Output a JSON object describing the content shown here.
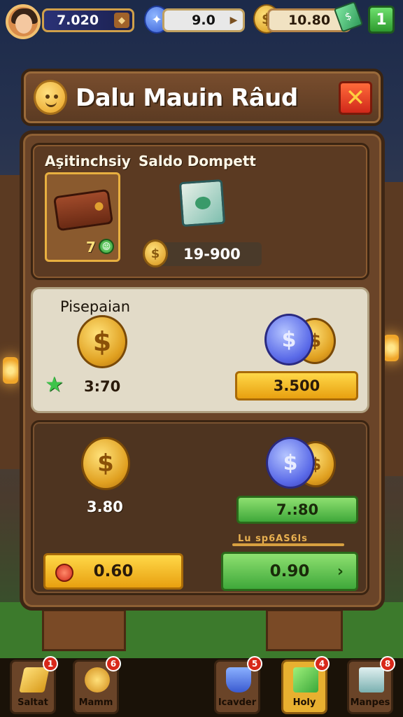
{
  "topbar": {
    "stat_1": "7.020",
    "stat_2": "9.0",
    "stat_3": "10.80",
    "plus_label": "1"
  },
  "dialog": {
    "title": "Dalu Mauin Râud",
    "close_label": "✕"
  },
  "wallet_section": {
    "label_left": "Aşitinchsiy",
    "label_right": "Saldo Dompett",
    "wallet_count": "7",
    "balance": "19-900"
  },
  "exchange_section": {
    "label": "Pisepaian",
    "left_value": "3:70",
    "right_button": "3.500"
  },
  "offer_section": {
    "left_value": "3.80",
    "right_button": "7.:80",
    "scribble": "Lu sp6AS6ls",
    "btn_left": "0.60",
    "btn_right": "0.90"
  },
  "bottom_nav": {
    "items": [
      {
        "label": "Saltat",
        "badge": "1",
        "icon": "gold-bar-icon"
      },
      {
        "label": "Mamm",
        "badge": "6",
        "icon": "coin-bag-icon"
      },
      {
        "label": "Icavder",
        "badge": "5",
        "icon": "blue-shield-icon"
      },
      {
        "label": "Holy",
        "badge": "4",
        "icon": "green-box-icon"
      },
      {
        "label": "Manpes",
        "badge": "8",
        "icon": "building-icon"
      }
    ]
  },
  "colors": {
    "accent_gold": "#e8b030",
    "button_green": "#3fa83a",
    "close_red": "#d0281a",
    "panel_brown": "#6a4428"
  }
}
